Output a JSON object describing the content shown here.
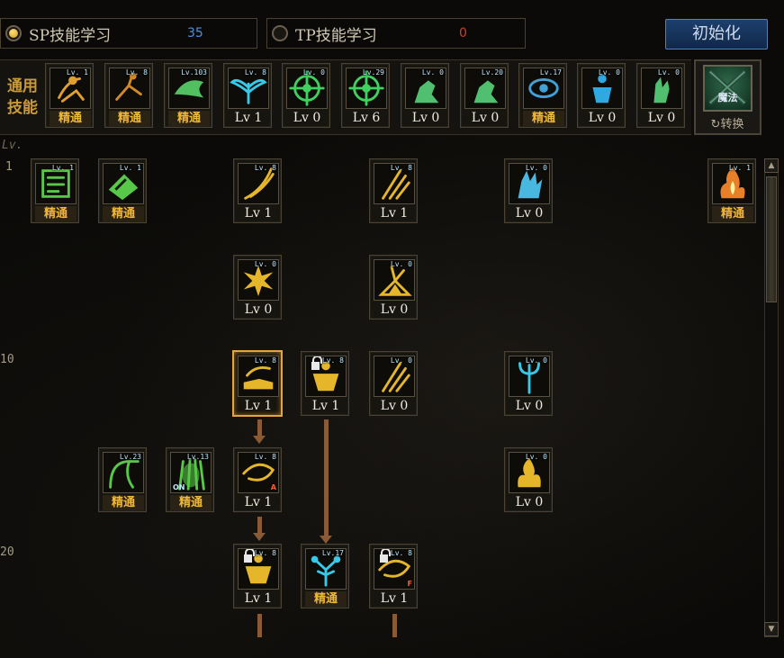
{
  "sp": {
    "label": "SP技能学习",
    "points": "35",
    "selected": true
  },
  "tp": {
    "label": "TP技能学习",
    "points": "0",
    "selected": false
  },
  "reset_button": "初始化",
  "general": {
    "title": "通用技能",
    "swap_label": "转换",
    "swap_icon_text": "魔法",
    "skills": [
      {
        "badge": "Lv. 1",
        "foot": "精通",
        "master": true,
        "color": "#e0a030",
        "glyph": "run"
      },
      {
        "badge": "Lv. 8",
        "foot": "精通",
        "master": true,
        "color": "#d08a28",
        "glyph": "kick"
      },
      {
        "badge": "Lv.103",
        "foot": "精通",
        "master": true,
        "color": "#52c060",
        "glyph": "tiger"
      },
      {
        "badge": "Lv. 8",
        "foot": "Lv 1",
        "master": false,
        "color": "#38c8e8",
        "glyph": "wings"
      },
      {
        "badge": "Lv. 0",
        "foot": "Lv 0",
        "master": false,
        "color": "#40d060",
        "glyph": "target"
      },
      {
        "badge": "Lv.29",
        "foot": "Lv 6",
        "master": false,
        "color": "#40d060",
        "glyph": "target"
      },
      {
        "badge": "Lv. 0",
        "foot": "Lv 0",
        "master": false,
        "color": "#50c070",
        "glyph": "fist"
      },
      {
        "badge": "Lv.20",
        "foot": "Lv 0",
        "master": false,
        "color": "#50c070",
        "glyph": "fist"
      },
      {
        "badge": "Lv.17",
        "foot": "精通",
        "master": true,
        "color": "#40a0d8",
        "glyph": "eye"
      },
      {
        "badge": "Lv. 0",
        "foot": "Lv 0",
        "master": false,
        "color": "#30a8e0",
        "glyph": "body"
      },
      {
        "badge": "Lv. 0",
        "foot": "Lv 0",
        "master": false,
        "color": "#50c070",
        "glyph": "hand"
      }
    ]
  },
  "tree": {
    "lv_header": "Lv.",
    "levels": [
      "1",
      "10",
      "20"
    ],
    "skills": [
      {
        "id": "t1",
        "badge": "Lv. 1",
        "foot": "精通",
        "master": true,
        "color": "#58c848",
        "glyph": "book"
      },
      {
        "id": "t2",
        "badge": "Lv. 1",
        "foot": "精通",
        "master": true,
        "color": "#58c848",
        "glyph": "tome"
      },
      {
        "id": "t3",
        "badge": "Lv. 8",
        "foot": "Lv 1",
        "master": false,
        "color": "#e6b62a",
        "glyph": "slash"
      },
      {
        "id": "t4",
        "badge": "Lv. 8",
        "foot": "Lv 1",
        "master": false,
        "color": "#e6b62a",
        "glyph": "claw"
      },
      {
        "id": "t5",
        "badge": "Lv. 0",
        "foot": "Lv 0",
        "master": false,
        "color": "#48b8e0",
        "glyph": "palm"
      },
      {
        "id": "t6",
        "badge": "Lv. 1",
        "foot": "精通",
        "master": true,
        "color": "#e8802a",
        "glyph": "fire"
      },
      {
        "id": "t7",
        "badge": "Lv. 0",
        "foot": "Lv 0",
        "master": false,
        "color": "#e6b62a",
        "glyph": "burst"
      },
      {
        "id": "t8",
        "badge": "Lv. 0",
        "foot": "Lv 0",
        "master": false,
        "color": "#e6b62a",
        "glyph": "star"
      },
      {
        "id": "t9",
        "badge": "Lv. 8",
        "foot": "Lv 1",
        "master": false,
        "color": "#e6b62a",
        "glyph": "shoe",
        "selected": true
      },
      {
        "id": "t10",
        "badge": "Lv. 8",
        "foot": "Lv 1",
        "master": false,
        "color": "#e6b62a",
        "glyph": "warrior",
        "locked": true
      },
      {
        "id": "t11",
        "badge": "Lv. 0",
        "foot": "Lv 0",
        "master": false,
        "color": "#e6b62a",
        "glyph": "claw"
      },
      {
        "id": "t12",
        "badge": "Lv. 0",
        "foot": "Lv 0",
        "master": false,
        "color": "#38c8e8",
        "glyph": "trident"
      },
      {
        "id": "t13",
        "badge": "Lv.23",
        "foot": "精通",
        "master": true,
        "color": "#58c848",
        "glyph": "arch"
      },
      {
        "id": "t14",
        "badge": "Lv.13",
        "foot": "精通",
        "master": true,
        "color": "#58c848",
        "glyph": "aura",
        "extra": "ON"
      },
      {
        "id": "t15",
        "badge": "Lv. 8",
        "foot": "Lv 1",
        "master": false,
        "color": "#e6b62a",
        "glyph": "swirl",
        "extra": "A"
      },
      {
        "id": "t16",
        "badge": "Lv. 0",
        "foot": "Lv 0",
        "master": false,
        "color": "#e6b62a",
        "glyph": "flame"
      },
      {
        "id": "t17",
        "badge": "Lv. 8",
        "foot": "Lv 1",
        "master": false,
        "color": "#e6b62a",
        "glyph": "warrior",
        "locked": true
      },
      {
        "id": "t18",
        "badge": "Lv.17",
        "foot": "精通",
        "master": true,
        "color": "#38c8e8",
        "glyph": "tree"
      },
      {
        "id": "t19",
        "badge": "Lv. 8",
        "foot": "Lv 1",
        "master": false,
        "color": "#e6b62a",
        "glyph": "swirl",
        "locked": true,
        "extra": "F"
      }
    ]
  }
}
